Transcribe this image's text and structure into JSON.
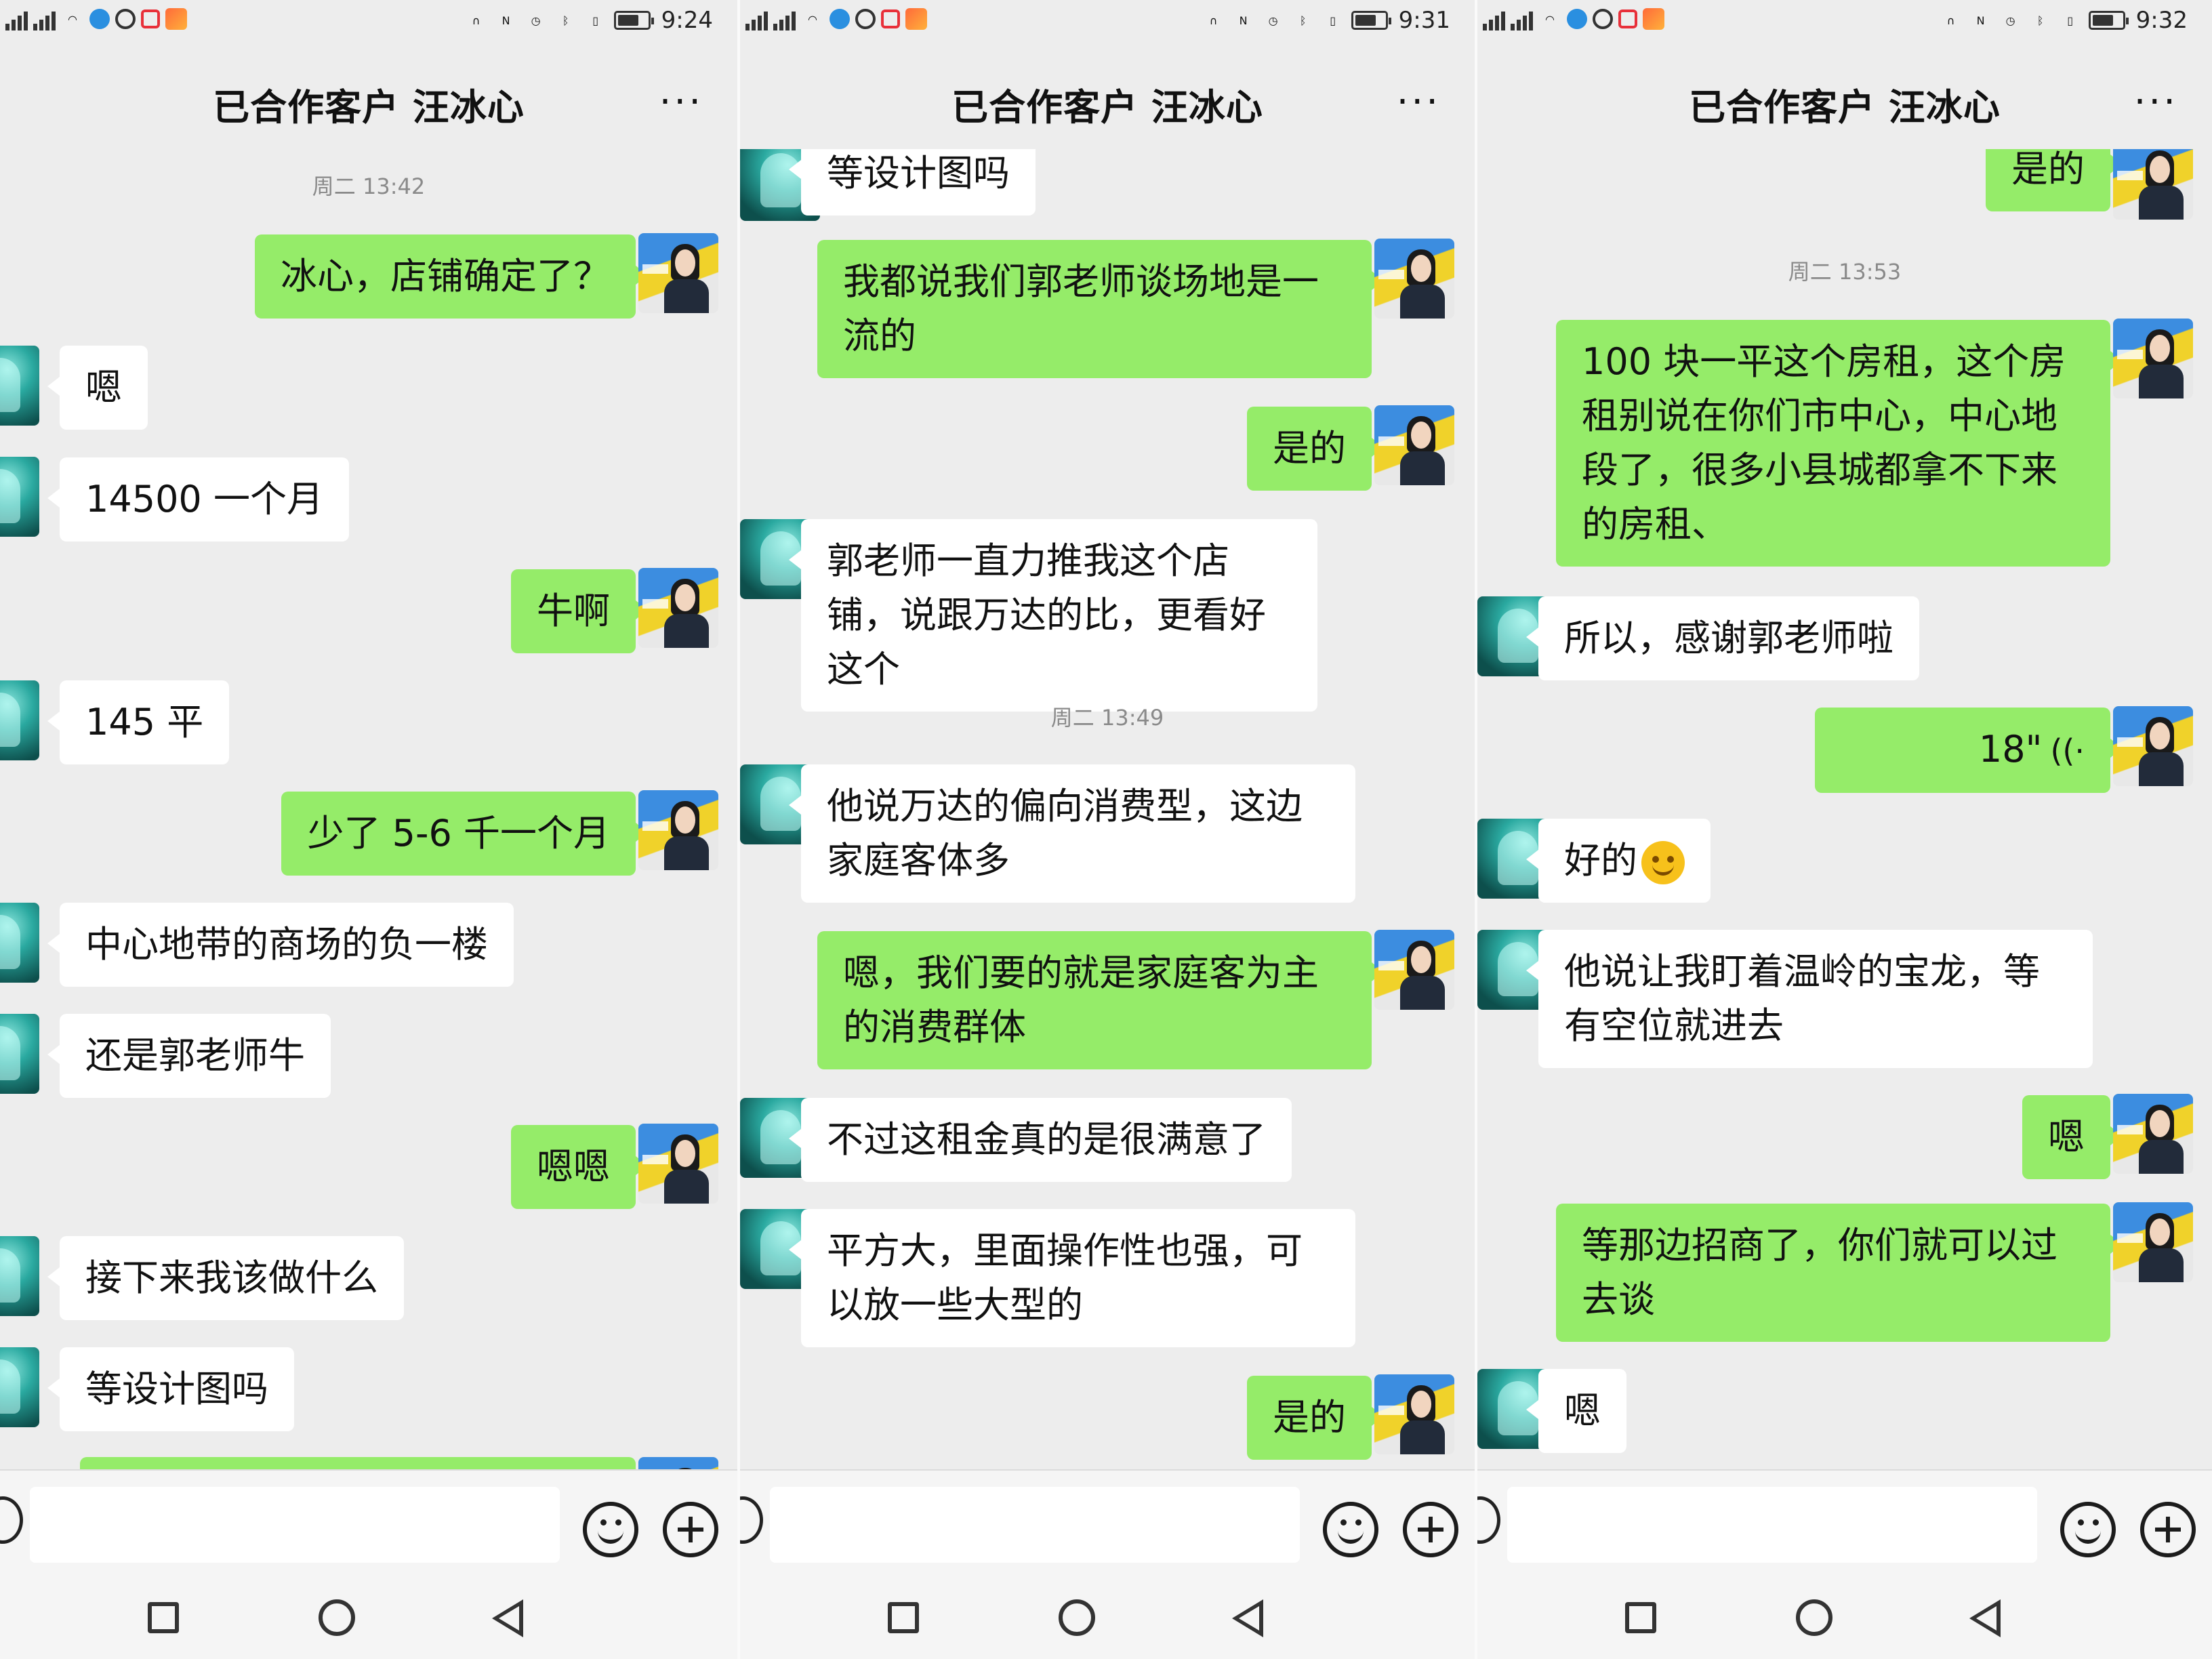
{
  "colors": {
    "sent_bubble": "#95ec69",
    "received_bubble": "#ffffff",
    "background": "#ededed"
  },
  "screens": [
    {
      "status_time": "9:24",
      "title": "已合作客户 汪冰心",
      "more_label": "···",
      "timestamps": [
        "周二 13:42"
      ],
      "messages": [
        "冰心，店铺确定了？",
        "嗯",
        "14500 一个月",
        "牛啊",
        "145 平",
        "少了 5-6 千一个月",
        "中心地带的商场的负一楼",
        "还是郭老师牛",
        "嗯嗯",
        "接下来我该做什么",
        "等设计图吗"
      ]
    },
    {
      "status_time": "9:31",
      "title": "已合作客户 汪冰心",
      "more_label": "···",
      "timestamps": [
        "周二 13:49"
      ],
      "messages": [
        "等设计图吗",
        "我都说我们郭老师谈场地是一流的",
        "是的",
        "郭老师一直力推我这个店铺，说跟万达的比，更看好这个",
        "他说万达的偏向消费型，这边家庭客体多",
        "嗯，我们要的就是家庭客为主的消费群体",
        "不过这租金真的是很满意了",
        "平方大，里面操作性也强，可以放一些大型的",
        "是的"
      ]
    },
    {
      "status_time": "9:32",
      "title": "已合作客户 汪冰心",
      "more_label": "···",
      "timestamps": [
        "周二 13:53"
      ],
      "messages": [
        "是的",
        "100 块一平这个房租，这个房租别说在你们市中心，中心地段了，很多小县城都拿不下来的房租、",
        "所以，感谢郭老师啦",
        "18\"",
        "好的",
        "他说让我盯着温岭的宝龙，等有空位就进去",
        "嗯",
        "等那边招商了，你们就可以过去谈",
        "嗯"
      ],
      "voice_icon": "((·"
    }
  ]
}
